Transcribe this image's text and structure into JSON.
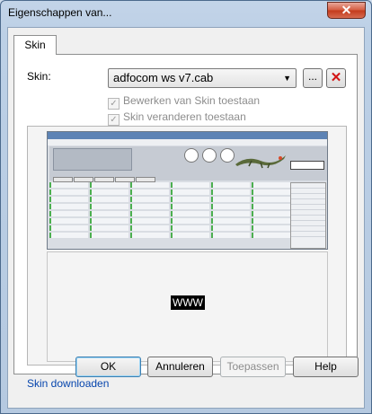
{
  "window": {
    "title": "Eigenschappen van...",
    "close_glyph": "✕"
  },
  "tabs": [
    {
      "label": "Skin"
    }
  ],
  "skin": {
    "label": "Skin:",
    "selected_value": "adfocom ws v7.cab",
    "browse_label": "...",
    "delete_icon": "red-x-icon"
  },
  "options": {
    "allow_edit_label": "Bewerken van Skin toestaan",
    "allow_edit_checked": true,
    "allow_change_label": "Skin veranderen toestaan",
    "allow_change_checked": true
  },
  "preview": {
    "placeholder_text": "WWW"
  },
  "links": {
    "download_label": "Skin downloaden"
  },
  "buttons": {
    "ok_label": "OK",
    "cancel_label": "Annuleren",
    "apply_label": "Toepassen",
    "help_label": "Help"
  },
  "colors": {
    "link": "#0645ad",
    "close_red": "#c3391b",
    "delete_red": "#d21414"
  }
}
